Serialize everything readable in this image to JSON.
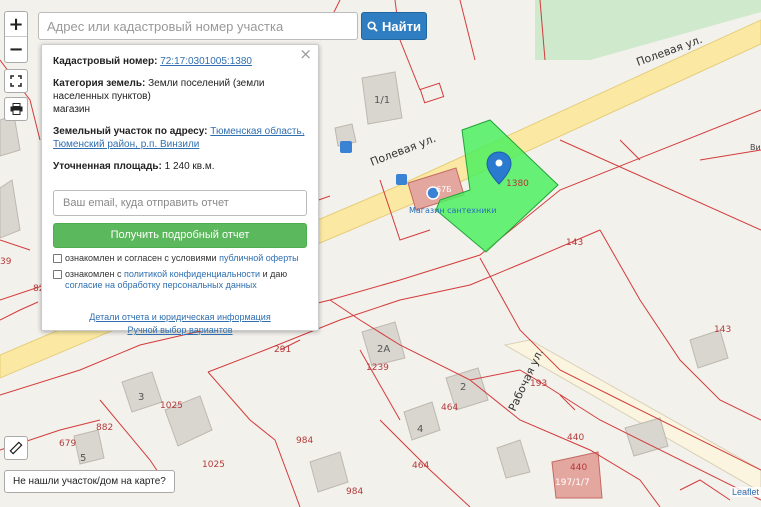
{
  "search": {
    "placeholder": "Адрес или кадастровый номер участка",
    "button_label": "Найти"
  },
  "zoom": {
    "in": "+",
    "out": "−"
  },
  "popup": {
    "close": "×",
    "cadastral_label": "Кадастровый номер:",
    "cadastral_number": "72:17:0301005:1380",
    "land_category_label": "Категория земель:",
    "land_category_value": "Земли поселений (земли населенных пунктов)",
    "land_use": "магазин",
    "address_label": "Земельный участок по адресу:",
    "address_value": "Тюменская область, Тюменский район, р.п. Винзили",
    "area_label": "Уточненная площадь:",
    "area_value": "1 240 кв.м.",
    "email_placeholder": "Ваш email, куда отправить отчет",
    "report_button": "Получить подробный отчет",
    "consent1_text": "ознакомлен и согласен с условиями ",
    "consent1_link": "публичной оферты",
    "consent2_text": "ознакомлен с ",
    "consent2_link": "политикой конфиденциальности",
    "consent2_mid": " и даю ",
    "consent2_link2": "согласие на обработку персональных данных",
    "details_link": "Детали отчета и юридическая информация",
    "manual_link": "Ручной выбор вариантов"
  },
  "not_found_button": "Не нашли участок/дом на карте?",
  "attribution": "Leaflet",
  "map": {
    "streets": [
      "Полевая ул.",
      "Полевая ул.",
      "Рабочая ул."
    ],
    "house_numbers": [
      "1/1",
      "2А",
      "2",
      "3",
      "4",
      "5",
      "67Б"
    ],
    "parcel_labels": [
      "1380",
      "143",
      "143",
      "291",
      "1239",
      "1025",
      "1025",
      "882",
      "984",
      "984",
      "464",
      "464",
      "440",
      "440",
      "679",
      "82",
      "39",
      "193",
      "197/1/7"
    ],
    "poi_label": "Магазин сантехники",
    "parcel_area_label": "Ви"
  },
  "colors": {
    "highlight_parcel": "#4cf060",
    "parcel_border": "#d33b3b",
    "road": "#fbe9a3",
    "search_button": "#2f7ec1",
    "report_button": "#5cb85c",
    "marker": "#2a7ad0"
  }
}
